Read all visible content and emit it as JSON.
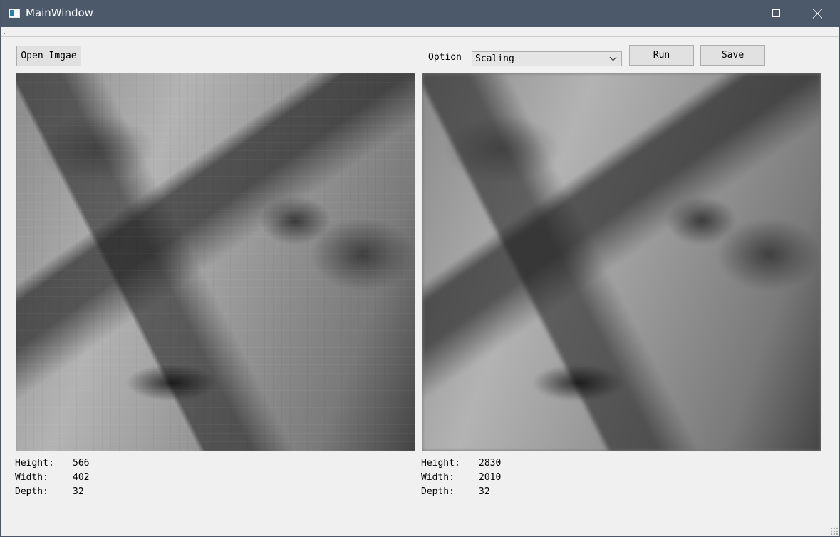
{
  "window": {
    "title": "MainWindow",
    "controls": {
      "minimize_icon": "minimize-icon",
      "maximize_icon": "maximize-icon",
      "close_icon": "close-icon"
    }
  },
  "toolbar": {
    "open_label": "Open Imgae",
    "option_label": "Option",
    "option_value": "Scaling",
    "run_label": "Run",
    "save_label": "Save"
  },
  "images": {
    "left": {
      "type": "grayscale close-up face",
      "info": [
        {
          "label": "Height:",
          "value": "566"
        },
        {
          "label": "Width:",
          "value": "402"
        },
        {
          "label": "Depth:",
          "value": "32"
        }
      ]
    },
    "right": {
      "type": "grayscale close-up face",
      "info": [
        {
          "label": "Height:",
          "value": "2830"
        },
        {
          "label": "Width:",
          "value": "2010"
        },
        {
          "label": "Depth:",
          "value": "32"
        }
      ]
    }
  },
  "colors": {
    "titlebar": "#4b596b",
    "background": "#f0f0f0",
    "button": "#e1e1e1",
    "border": "#adadad"
  }
}
